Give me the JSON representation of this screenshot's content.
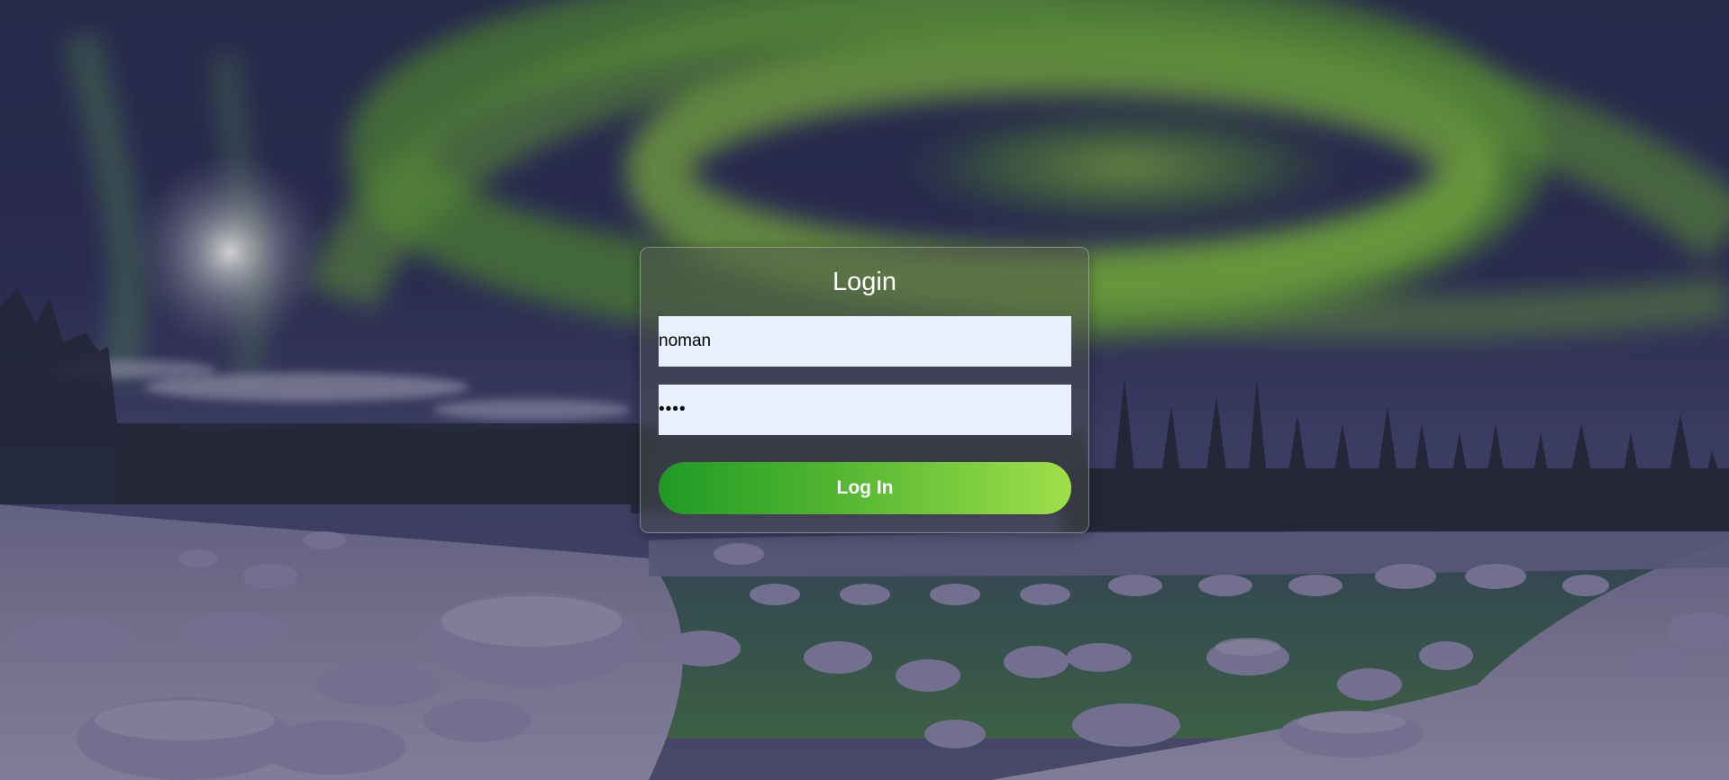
{
  "page": {
    "background": "aurora-borealis-winter-landscape"
  },
  "login": {
    "title": "Login",
    "username_value": "noman",
    "password_value": "••••",
    "submit_label": "Log In"
  },
  "colors": {
    "button_gradient_start": "#1f9a25",
    "button_gradient_end": "#9fe04a",
    "input_background": "#e8effd",
    "title_text": "#ffffff"
  }
}
